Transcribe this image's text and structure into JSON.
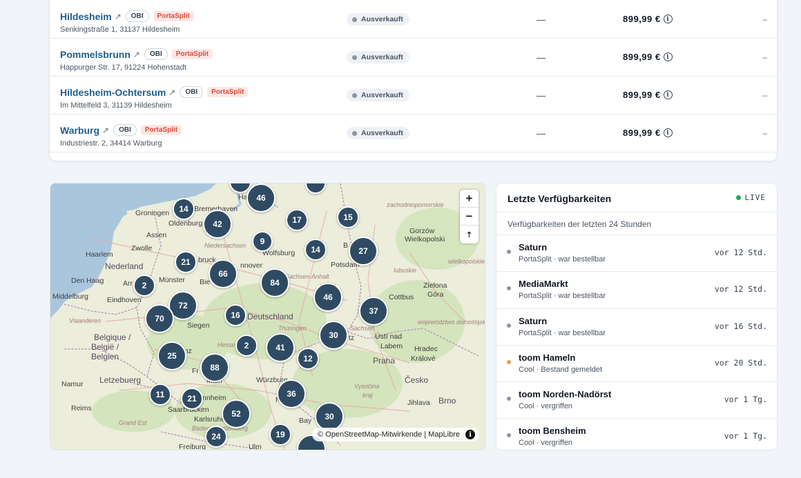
{
  "stores": [
    {
      "name": "Hildesheim",
      "chip_obi": "OBI",
      "chip_porta": "PortaSplit",
      "address": "Senkingstraße 1, 31137 Hildesheim",
      "status": "Ausverkauft",
      "mid": "—",
      "price": "899,99 €",
      "end": "–"
    },
    {
      "name": "Pommelsbrunn",
      "chip_obi": "OBI",
      "chip_porta": "PortaSplit",
      "address": "Happurger Str. 17, 91224 Hohenstadt",
      "status": "Ausverkauft",
      "mid": "—",
      "price": "899,99 €",
      "end": "–"
    },
    {
      "name": "Hildesheim-Ochtersum",
      "chip_obi": "OBI",
      "chip_porta": "PortaSplit",
      "address": "Im Mittelfeld 3, 31139 Hildesheim",
      "status": "Ausverkauft",
      "mid": "—",
      "price": "899,99 €",
      "end": "–"
    },
    {
      "name": "Warburg",
      "chip_obi": "OBI",
      "chip_porta": "PortaSplit",
      "address": "Industriestr. 2, 34414 Warburg",
      "status": "Ausverkauft",
      "mid": "—",
      "price": "899,99 €",
      "end": "–"
    }
  ],
  "map": {
    "zoom_in": "+",
    "zoom_out": "−",
    "compass": "⇡",
    "attribution": "© OpenStreetMap-Mitwirkende | MapLibre",
    "attribution_info": "i",
    "labels": [
      {
        "text": "Groningen",
        "kind": "city"
      },
      {
        "text": "Bremerhaven",
        "kind": "city"
      },
      {
        "text": "Oldenburg",
        "kind": "city"
      },
      {
        "text": "Assen",
        "kind": "city"
      },
      {
        "text": "Zwolle",
        "kind": "city"
      },
      {
        "text": "Haarlem",
        "kind": "city"
      },
      {
        "text": "Nederland",
        "kind": "country"
      },
      {
        "text": "Den Haag",
        "kind": "city"
      },
      {
        "text": "Niedersachsen",
        "kind": "region"
      },
      {
        "text": "Wolfsburg",
        "kind": "city"
      },
      {
        "text": "nnover",
        "kind": "city"
      },
      {
        "text": "Münster",
        "kind": "city"
      },
      {
        "text": "bruck",
        "kind": "city"
      },
      {
        "text": "Bie",
        "kind": "city"
      },
      {
        "text": "Middelburg",
        "kind": "city"
      },
      {
        "text": "Eindhoven",
        "kind": "city"
      },
      {
        "text": "Arr",
        "kind": "city"
      },
      {
        "text": "Vlaanderen",
        "kind": "region"
      },
      {
        "text": "Siegen",
        "kind": "city"
      },
      {
        "text": "Deutschland",
        "kind": "country"
      },
      {
        "text": "Thüringen",
        "kind": "region"
      },
      {
        "text": "Belgique /",
        "kind": "country"
      },
      {
        "text": "België /",
        "kind": "country"
      },
      {
        "text": "Belgien",
        "kind": "country"
      },
      {
        "text": "Hesse",
        "kind": "region"
      },
      {
        "text": "Sachsen",
        "kind": "region"
      },
      {
        "text": "Letzebuerg",
        "kind": "country"
      },
      {
        "text": "Reims",
        "kind": "city"
      },
      {
        "text": "Saarbrücken",
        "kind": "city"
      },
      {
        "text": "Grand Est",
        "kind": "region"
      },
      {
        "text": "Karlsruhe",
        "kind": "city"
      },
      {
        "text": "Freiburg",
        "kind": "city"
      },
      {
        "text": "Würzburg",
        "kind": "city"
      },
      {
        "text": "Nu",
        "kind": "city"
      },
      {
        "text": "Praha",
        "kind": "city"
      },
      {
        "text": "Česko",
        "kind": "country"
      },
      {
        "text": "Ústí nad",
        "kind": "city"
      },
      {
        "text": "Labem",
        "kind": "city"
      },
      {
        "text": "Hradec",
        "kind": "city"
      },
      {
        "text": "Králové",
        "kind": "city"
      },
      {
        "text": "Brno",
        "kind": "city"
      },
      {
        "text": "Jihlava",
        "kind": "city"
      },
      {
        "text": "Gorzów",
        "kind": "city"
      },
      {
        "text": "Wielkopolski",
        "kind": "city"
      },
      {
        "text": "Zielona",
        "kind": "city"
      },
      {
        "text": "Góra",
        "kind": "city"
      },
      {
        "text": "Cottbus",
        "kind": "city"
      },
      {
        "text": "Potsdam",
        "kind": "city"
      },
      {
        "text": "Namur",
        "kind": "city"
      },
      {
        "text": "Ulm",
        "kind": "city"
      },
      {
        "text": "Bay",
        "kind": "city"
      },
      {
        "text": "nnheim",
        "kind": "city"
      },
      {
        "text": "Fr",
        "kind": "city"
      },
      {
        "text": "Main",
        "kind": "city"
      },
      {
        "text": "enz",
        "kind": "city"
      },
      {
        "text": "tz",
        "kind": "city"
      },
      {
        "text": "Ha",
        "kind": "city"
      },
      {
        "text": "B",
        "kind": "city"
      },
      {
        "text": "zachodniopomorskie",
        "kind": "region"
      },
      {
        "text": "wielkopolskie",
        "kind": "region"
      },
      {
        "text": "lubuskie",
        "kind": "region"
      },
      {
        "text": "województwo dolnośląskie",
        "kind": "region"
      },
      {
        "text": "Sachsen-Anhalt",
        "kind": "region"
      },
      {
        "text": "Vysočina",
        "kind": "region"
      },
      {
        "text": "kraj",
        "kind": "region"
      },
      {
        "text": "Baden-Württemberg",
        "kind": "region"
      }
    ],
    "clusters": [
      {
        "count": "46"
      },
      {
        "count": "14"
      },
      {
        "count": "42"
      },
      {
        "count": "17"
      },
      {
        "count": "15"
      },
      {
        "count": "9"
      },
      {
        "count": "14"
      },
      {
        "count": "27"
      },
      {
        "count": "21"
      },
      {
        "count": "66"
      },
      {
        "count": "84"
      },
      {
        "count": "2"
      },
      {
        "count": "72"
      },
      {
        "count": "46"
      },
      {
        "count": "37"
      },
      {
        "count": "70"
      },
      {
        "count": "16"
      },
      {
        "count": "30"
      },
      {
        "count": "2"
      },
      {
        "count": "41"
      },
      {
        "count": "25"
      },
      {
        "count": "88"
      },
      {
        "count": "12"
      },
      {
        "count": "11"
      },
      {
        "count": "21"
      },
      {
        "count": "36"
      },
      {
        "count": "52"
      },
      {
        "count": "30"
      },
      {
        "count": "19"
      },
      {
        "count": "24"
      }
    ]
  },
  "panel": {
    "title": "Letzte Verfügbarkeiten",
    "live": "LIVE",
    "live_color": "#22a55b",
    "subtitle": "Verfügbarkeiten der letzten 24 Stunden",
    "items": [
      {
        "title": "Saturn",
        "sub": "PortaSplit · war bestellbar",
        "time": "vor 12 Std.",
        "dot": "#8b95a3"
      },
      {
        "title": "MediaMarkt",
        "sub": "PortaSplit · war bestellbar",
        "time": "vor 12 Std.",
        "dot": "#8b95a3"
      },
      {
        "title": "Saturn",
        "sub": "PortaSplit · war bestellbar",
        "time": "vor 16 Std.",
        "dot": "#8b95a3"
      },
      {
        "title": "toom Hameln",
        "sub": "Cool · Bestand gemeldet",
        "time": "vor 20 Std.",
        "dot": "#e0a548"
      },
      {
        "title": "toom Norden-Nadörst",
        "sub": "Cool · vergriffen",
        "time": "vor 1 Tg.",
        "dot": "#8b95a3"
      },
      {
        "title": "toom Bensheim",
        "sub": "Cool · vergriffen",
        "time": "vor 1 Tg.",
        "dot": "#8b95a3"
      }
    ]
  }
}
